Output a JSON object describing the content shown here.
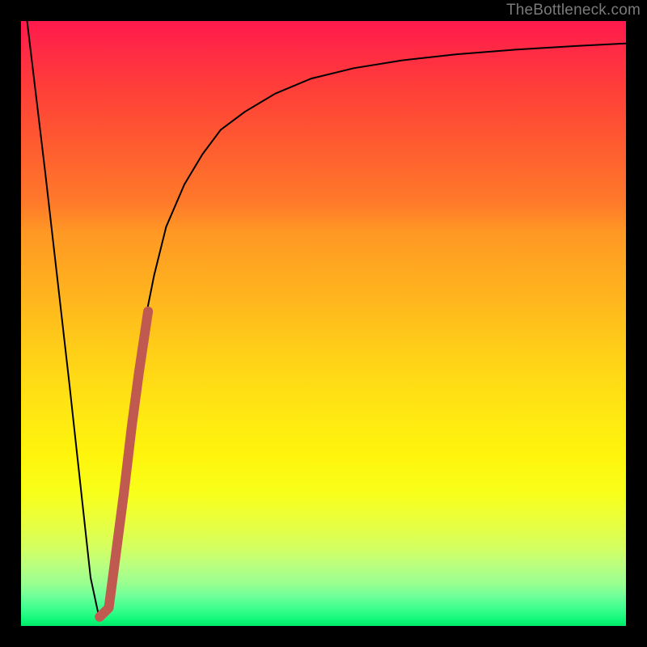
{
  "watermark": "TheBottleneck.com",
  "chart_data": {
    "type": "line",
    "title": "",
    "xlabel": "",
    "ylabel": "",
    "xlim": [
      0,
      100
    ],
    "ylim": [
      0,
      100
    ],
    "series": [
      {
        "name": "curve",
        "color": "#000000",
        "width": 2,
        "x": [
          1,
          4,
          8,
          11.5,
          13,
          14.5,
          15.5,
          16.5,
          18,
          20,
          22,
          24,
          27,
          30,
          33,
          37,
          42,
          48,
          55,
          63,
          72,
          82,
          92,
          100
        ],
        "values": [
          100,
          75,
          40,
          8,
          1,
          3,
          11,
          20,
          33,
          48,
          58,
          66,
          73,
          78,
          82,
          85,
          88,
          90.5,
          92.2,
          93.5,
          94.5,
          95.3,
          95.9,
          96.3
        ]
      },
      {
        "name": "highlight",
        "color": "#c05a50",
        "width": 12,
        "x": [
          13.0,
          14.5,
          15.7,
          17.0,
          18.3,
          19.5,
          21.0
        ],
        "values": [
          1.5,
          3.0,
          12.0,
          22.0,
          33.0,
          42.0,
          52.0
        ]
      }
    ],
    "background_gradient": {
      "top": "#ff1a4d",
      "mid": "#ffe812",
      "bottom": "#00e868"
    }
  }
}
